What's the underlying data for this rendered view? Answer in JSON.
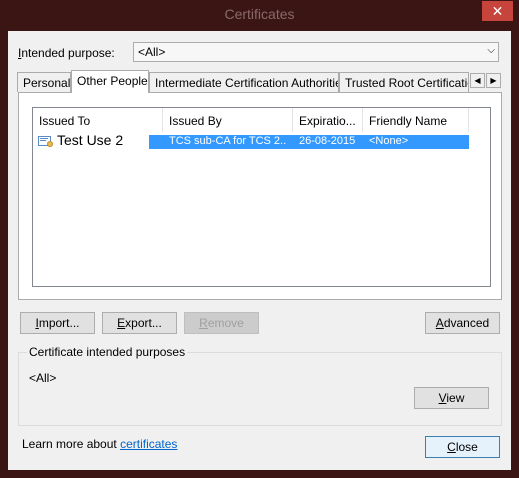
{
  "window": {
    "title": "Certificates",
    "close_glyph": "✕"
  },
  "intended_purpose": {
    "label_hot": "I",
    "label_rest": "ntended purpose:",
    "value": "<All>"
  },
  "tabs": [
    {
      "label": "Personal"
    },
    {
      "label": "Other People",
      "active": true
    },
    {
      "label": "Intermediate Certification Authorities"
    },
    {
      "label": "Trusted Root Certification"
    }
  ],
  "tab_scroll": {
    "left": "◀",
    "right": "▶"
  },
  "list": {
    "columns": [
      "Issued To",
      "Issued By",
      "Expiratio...",
      "Friendly Name"
    ],
    "rows": [
      {
        "issued_to": "Test Use 2",
        "issued_by": "TCS sub-CA for TCS 2...",
        "expiration": "26-08-2015",
        "friendly_name": "<None>"
      }
    ]
  },
  "buttons": {
    "import_hot": "I",
    "import_rest": "mport...",
    "export_hot": "E",
    "export_rest": "xport...",
    "remove_hot": "R",
    "remove_rest": "emove",
    "advanced_hot": "A",
    "advanced_rest": "dvanced",
    "view_hot": "V",
    "view_rest": "iew",
    "close_hot": "C",
    "close_rest": "lose"
  },
  "purposes": {
    "title": "Certificate intended purposes",
    "value": "<All>"
  },
  "footer": {
    "learn_prefix": "Learn more about ",
    "learn_link": "certificates"
  },
  "colors": {
    "selection": "#3399ff",
    "frame": "#3b1414",
    "close_button": "#c7443c",
    "link": "#0066cc"
  }
}
